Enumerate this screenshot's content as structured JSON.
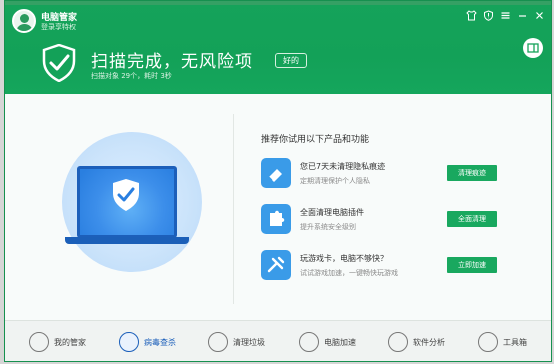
{
  "header": {
    "app_title": "电脑管家",
    "login_link": "登录享特权",
    "scan_title": "扫描完成，无风险项",
    "good_badge": "好的",
    "scan_summary": "扫描对象 29个，耗时 3秒",
    "window_icons": [
      "shirt-icon",
      "shield-icon",
      "menu-icon",
      "minimize-icon",
      "close-icon"
    ]
  },
  "recommend": {
    "title": "推荐你试用以下产品和功能",
    "items": [
      {
        "name": "您已7天未清理隐私痕迹",
        "desc": "定期清理保护个人隐私",
        "button": "清理痕迹",
        "icon": "eraser-icon"
      },
      {
        "name": "全面清理电脑插件",
        "desc": "提升系统安全级别",
        "button": "全面清理",
        "icon": "puzzle-icon"
      },
      {
        "name": "玩游戏卡，电脑不够快？",
        "desc": "试试游戏加速，一键畅快玩游戏",
        "button": "立即加速",
        "icon": "game-speed-icon"
      }
    ]
  },
  "footer": {
    "tabs": [
      {
        "label": "我的管家",
        "icon": "avatar-icon"
      },
      {
        "label": "病毒查杀",
        "icon": "virus-scan-icon"
      },
      {
        "label": "清理垃圾",
        "icon": "broom-icon"
      },
      {
        "label": "电脑加速",
        "icon": "rocket-icon"
      },
      {
        "label": "软件分析",
        "icon": "analysis-icon"
      },
      {
        "label": "工具箱",
        "icon": "toolbox-icon"
      }
    ]
  },
  "colors": {
    "brand_green": "#15a35a",
    "accent_blue": "#1c5fba",
    "button_green": "#19a85f"
  }
}
